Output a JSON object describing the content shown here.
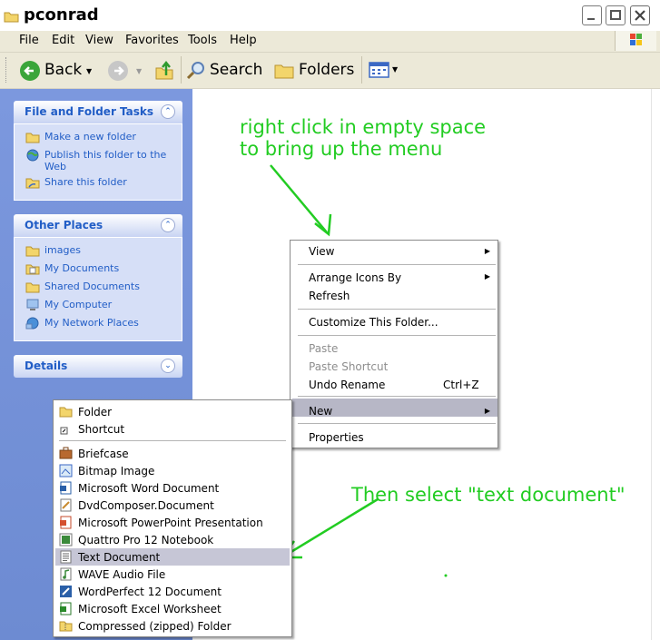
{
  "window": {
    "title": "pconrad"
  },
  "menubar": {
    "items": [
      "File",
      "Edit",
      "View",
      "Favorites",
      "Tools",
      "Help"
    ]
  },
  "toolbar": {
    "back": "Back",
    "search": "Search",
    "folders": "Folders"
  },
  "left_pane": {
    "file_tasks": {
      "title": "File and Folder Tasks",
      "items": [
        "Make a new folder",
        "Publish this folder to the Web",
        "Share this folder"
      ]
    },
    "other_places": {
      "title": "Other Places",
      "items": [
        "images",
        "My Documents",
        "Shared Documents",
        "My Computer",
        "My Network Places"
      ]
    },
    "details": {
      "title": "Details"
    }
  },
  "context_menu": {
    "view": "View",
    "arrange": "Arrange Icons By",
    "refresh": "Refresh",
    "customize": "Customize This Folder...",
    "paste": "Paste",
    "paste_shortcut": "Paste Shortcut",
    "undo": "Undo Rename",
    "undo_shortcut": "Ctrl+Z",
    "new": "New",
    "properties": "Properties"
  },
  "new_submenu": {
    "items": [
      "Folder",
      "Shortcut",
      "Briefcase",
      "Bitmap Image",
      "Microsoft Word Document",
      "DvdComposer.Document",
      "Microsoft PowerPoint Presentation",
      "Quattro Pro 12 Notebook",
      "Text Document",
      "WAVE Audio File",
      "WordPerfect 12 Document",
      "Microsoft Excel Worksheet",
      "Compressed (zipped) Folder"
    ],
    "highlighted": "Text Document"
  },
  "annotations": {
    "line1": "right click in empty space",
    "line2": "to bring up the menu",
    "line3": "Then select \"text document\"",
    "color": "#22cc22"
  },
  "colors": {
    "left_pane": "#7c98de",
    "panel_title": "#215dc6",
    "menu_highlight": "#b7b7c6"
  }
}
